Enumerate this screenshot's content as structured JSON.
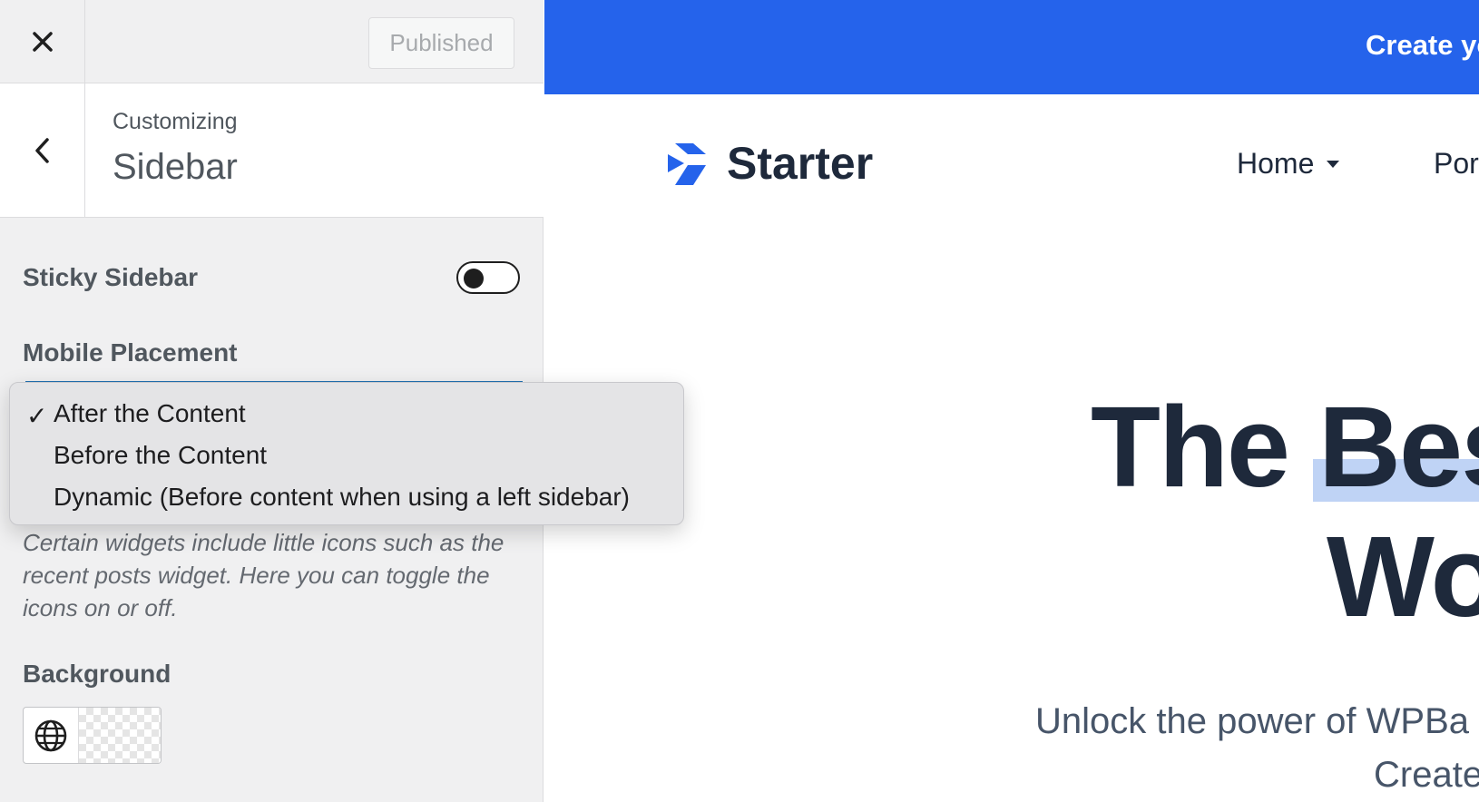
{
  "customizer": {
    "published_label": "Published",
    "breadcrumb": "Customizing",
    "section_title": "Sidebar",
    "sticky_sidebar": {
      "label": "Sticky Sidebar",
      "enabled": false
    },
    "mobile_placement": {
      "label": "Mobile Placement",
      "selected": "After the Content",
      "options": [
        "After the Content",
        "Before the Content",
        "Dynamic (Before content when using a left sidebar)"
      ]
    },
    "widget_icons_description": "Certain widgets include little icons such as the recent posts widget. Here you can toggle the icons on or off.",
    "background": {
      "label": "Background"
    },
    "icons": [
      "close-icon",
      "chevron-left-icon",
      "globe-icon"
    ]
  },
  "preview": {
    "banner_text": "Create yo",
    "brand_name": "Starter",
    "nav": [
      "Home",
      "Por"
    ],
    "hero_line_1": "The Bes",
    "hero_line_2": "Wo",
    "subheading_line_1": "Unlock the power of WPBa",
    "subheading_line_2": "Create"
  },
  "colors": {
    "banner": "#2563eb",
    "panel_bg": "#f0f0f1",
    "heading": "#1e293b",
    "highlight": "#bfd3f5"
  }
}
